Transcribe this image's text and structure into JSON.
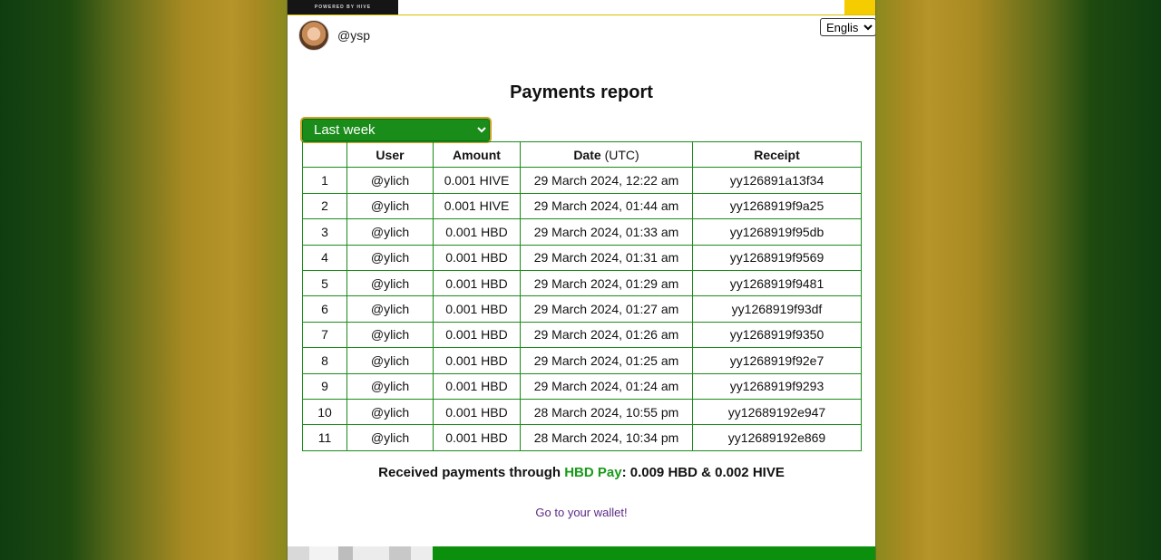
{
  "header": {
    "logo_text": "POWERED BY HIVE",
    "username": "@ysp",
    "language": "English"
  },
  "report": {
    "title": "Payments report",
    "period": "Last week",
    "columns": {
      "user": "User",
      "amount": "Amount",
      "date": "Date",
      "date_suffix": "(UTC)",
      "receipt": "Receipt"
    },
    "rows": [
      {
        "n": "1",
        "user": "@ylich",
        "amount": "0.001 HIVE",
        "date": "29 March 2024, 12:22 am",
        "receipt": "yy126891a13f34"
      },
      {
        "n": "2",
        "user": "@ylich",
        "amount": "0.001 HIVE",
        "date": "29 March 2024, 01:44 am",
        "receipt": "yy1268919f9a25"
      },
      {
        "n": "3",
        "user": "@ylich",
        "amount": "0.001 HBD",
        "date": "29 March 2024, 01:33 am",
        "receipt": "yy1268919f95db"
      },
      {
        "n": "4",
        "user": "@ylich",
        "amount": "0.001 HBD",
        "date": "29 March 2024, 01:31 am",
        "receipt": "yy1268919f9569"
      },
      {
        "n": "5",
        "user": "@ylich",
        "amount": "0.001 HBD",
        "date": "29 March 2024, 01:29 am",
        "receipt": "yy1268919f9481"
      },
      {
        "n": "6",
        "user": "@ylich",
        "amount": "0.001 HBD",
        "date": "29 March 2024, 01:27 am",
        "receipt": "yy1268919f93df"
      },
      {
        "n": "7",
        "user": "@ylich",
        "amount": "0.001 HBD",
        "date": "29 March 2024, 01:26 am",
        "receipt": "yy1268919f9350"
      },
      {
        "n": "8",
        "user": "@ylich",
        "amount": "0.001 HBD",
        "date": "29 March 2024, 01:25 am",
        "receipt": "yy1268919f92e7"
      },
      {
        "n": "9",
        "user": "@ylich",
        "amount": "0.001 HBD",
        "date": "29 March 2024, 01:24 am",
        "receipt": "yy1268919f9293"
      },
      {
        "n": "10",
        "user": "@ylich",
        "amount": "0.001 HBD",
        "date": "28 March 2024, 10:55 pm",
        "receipt": "yy12689192e947"
      },
      {
        "n": "11",
        "user": "@ylich",
        "amount": "0.001 HBD",
        "date": "28 March 2024, 10:34 pm",
        "receipt": "yy12689192e869"
      }
    ]
  },
  "summary": {
    "prefix": "Received payments through ",
    "brand": "HBD Pay",
    "totals": ": 0.009 HBD & 0.002 HIVE"
  },
  "wallet_link": "Go to your wallet!",
  "colors": {
    "brand_green": "#1a9a1a",
    "table_border": "#1a8c1a",
    "accent_yellow": "#f4cc00",
    "link_purple": "#5b2a86"
  }
}
